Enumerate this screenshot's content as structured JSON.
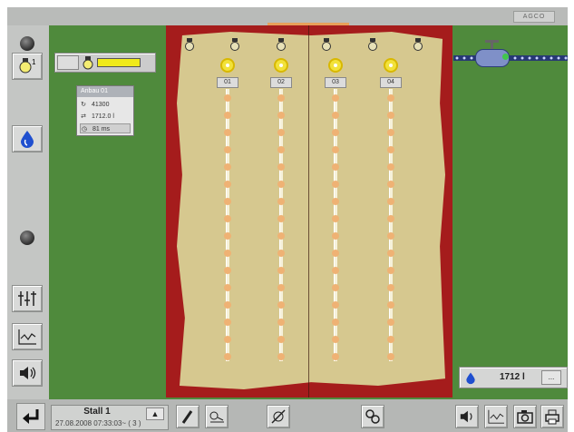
{
  "logo": "AGCO",
  "left_toolbar": {
    "top_buttons": [
      {
        "name": "dot-icon"
      },
      {
        "name": "lamp-one-button",
        "label": "1"
      },
      {
        "name": "water-drop-button"
      }
    ],
    "bottom_buttons": [
      {
        "name": "mixer-settings-button"
      },
      {
        "name": "chart-button"
      },
      {
        "name": "speaker-button"
      }
    ]
  },
  "control": {
    "bar_color": "#f0ea19"
  },
  "info_box": {
    "title": "Anbau 01",
    "rows": [
      {
        "icon": "rotation-icon",
        "value": "41300"
      },
      {
        "icon": "feed-icon",
        "value": "1712.0 l"
      },
      {
        "icon": "timer-icon",
        "value": "81 ms"
      }
    ]
  },
  "feed_lines": [
    {
      "label": "01"
    },
    {
      "label": "02"
    },
    {
      "label": "03"
    },
    {
      "label": "04"
    }
  ],
  "lamps_count": 6,
  "water": {
    "value": "1712 l",
    "button_label": "..."
  },
  "stall": {
    "name": "Stall 1",
    "datetime": "27.08.2008 07:33:03~ ( 3 )"
  },
  "bottom_toolbar": {
    "buttons": [
      "brush-tool-button",
      "feeder-tool-button",
      "no-light-button",
      "gears-button",
      "speaker-button",
      "chart-button",
      "camera-button",
      "print-button"
    ]
  },
  "colors": {
    "grass": "#4f8a3c",
    "house_wall": "#a51c1c",
    "floor": "#d6c88f",
    "feeder": "#f2e23a",
    "pan": "#efb274",
    "chain": "#273874"
  }
}
